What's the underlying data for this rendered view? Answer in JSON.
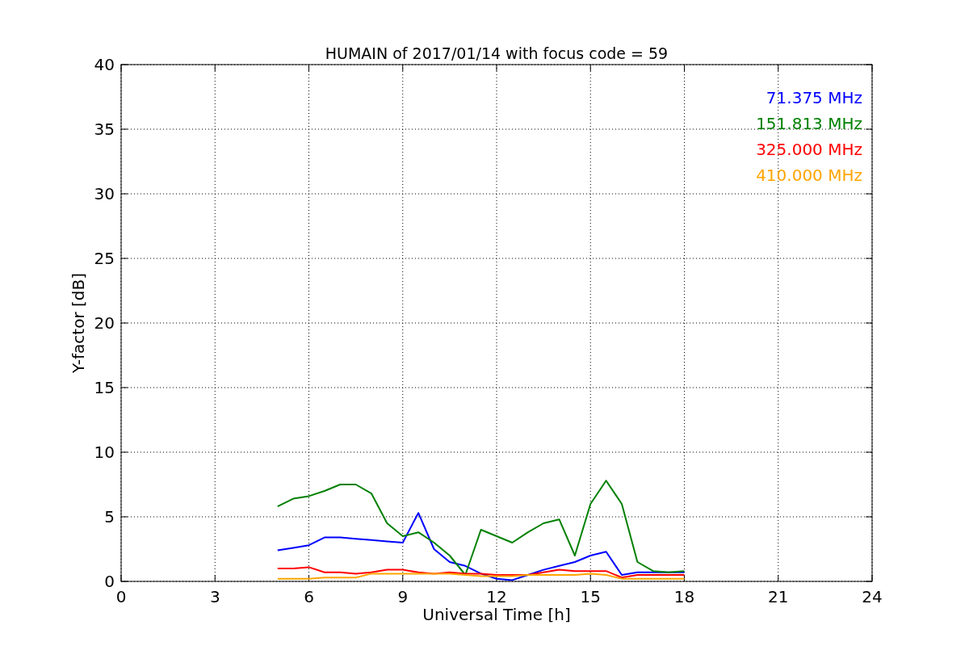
{
  "figure": {
    "chart_data": {
      "type": "line",
      "title": "HUMAIN of 2017/01/14 with focus code = 59",
      "xlabel": "Universal Time [h]",
      "ylabel": "Y-factor [dB]",
      "x": [
        5,
        5.5,
        6,
        6.5,
        7,
        7.5,
        8,
        8.5,
        9,
        9.5,
        10,
        10.5,
        11,
        11.5,
        12,
        12.5,
        13,
        13.5,
        14,
        14.5,
        15,
        15.5,
        16,
        16.5,
        17,
        17.5,
        18
      ],
      "series": [
        {
          "name": "71.375 MHz",
          "color": "#0000ff",
          "values": [
            2.4,
            2.6,
            2.8,
            3.4,
            3.4,
            3.3,
            3.2,
            3.1,
            3.0,
            5.3,
            2.5,
            1.5,
            1.2,
            0.6,
            0.2,
            0.1,
            0.5,
            0.9,
            1.2,
            1.5,
            2.0,
            2.3,
            0.5,
            0.7,
            0.7,
            0.7,
            0.7
          ]
        },
        {
          "name": "151.813 MHz",
          "color": "#008000",
          "values": [
            5.8,
            6.4,
            6.6,
            7.0,
            7.5,
            7.5,
            6.8,
            4.5,
            3.5,
            3.8,
            3.0,
            2.0,
            0.5,
            4.0,
            3.5,
            3.0,
            3.8,
            4.5,
            4.8,
            2.0,
            6.0,
            7.8,
            6.0,
            1.5,
            0.8,
            0.7,
            0.8
          ]
        },
        {
          "name": "325.000 MHz",
          "color": "#ff0000",
          "values": [
            1.0,
            1.0,
            1.1,
            0.7,
            0.7,
            0.6,
            0.7,
            0.9,
            0.9,
            0.7,
            0.6,
            0.7,
            0.6,
            0.6,
            0.5,
            0.5,
            0.5,
            0.7,
            0.9,
            0.8,
            0.8,
            0.8,
            0.3,
            0.5,
            0.5,
            0.5,
            0.5
          ]
        },
        {
          "name": "410.000 MHz",
          "color": "#ffa500",
          "values": [
            0.2,
            0.2,
            0.2,
            0.3,
            0.3,
            0.3,
            0.6,
            0.6,
            0.6,
            0.6,
            0.6,
            0.6,
            0.5,
            0.4,
            0.4,
            0.4,
            0.5,
            0.5,
            0.5,
            0.5,
            0.6,
            0.5,
            0.2,
            0.2,
            0.2,
            0.2,
            0.2
          ]
        }
      ],
      "xlim": [
        0,
        24
      ],
      "ylim": [
        0,
        40
      ],
      "xticks": [
        0,
        3,
        6,
        9,
        12,
        15,
        18,
        21,
        24
      ],
      "yticks": [
        0,
        5,
        10,
        15,
        20,
        25,
        30,
        35,
        40
      ],
      "grid": true
    }
  }
}
